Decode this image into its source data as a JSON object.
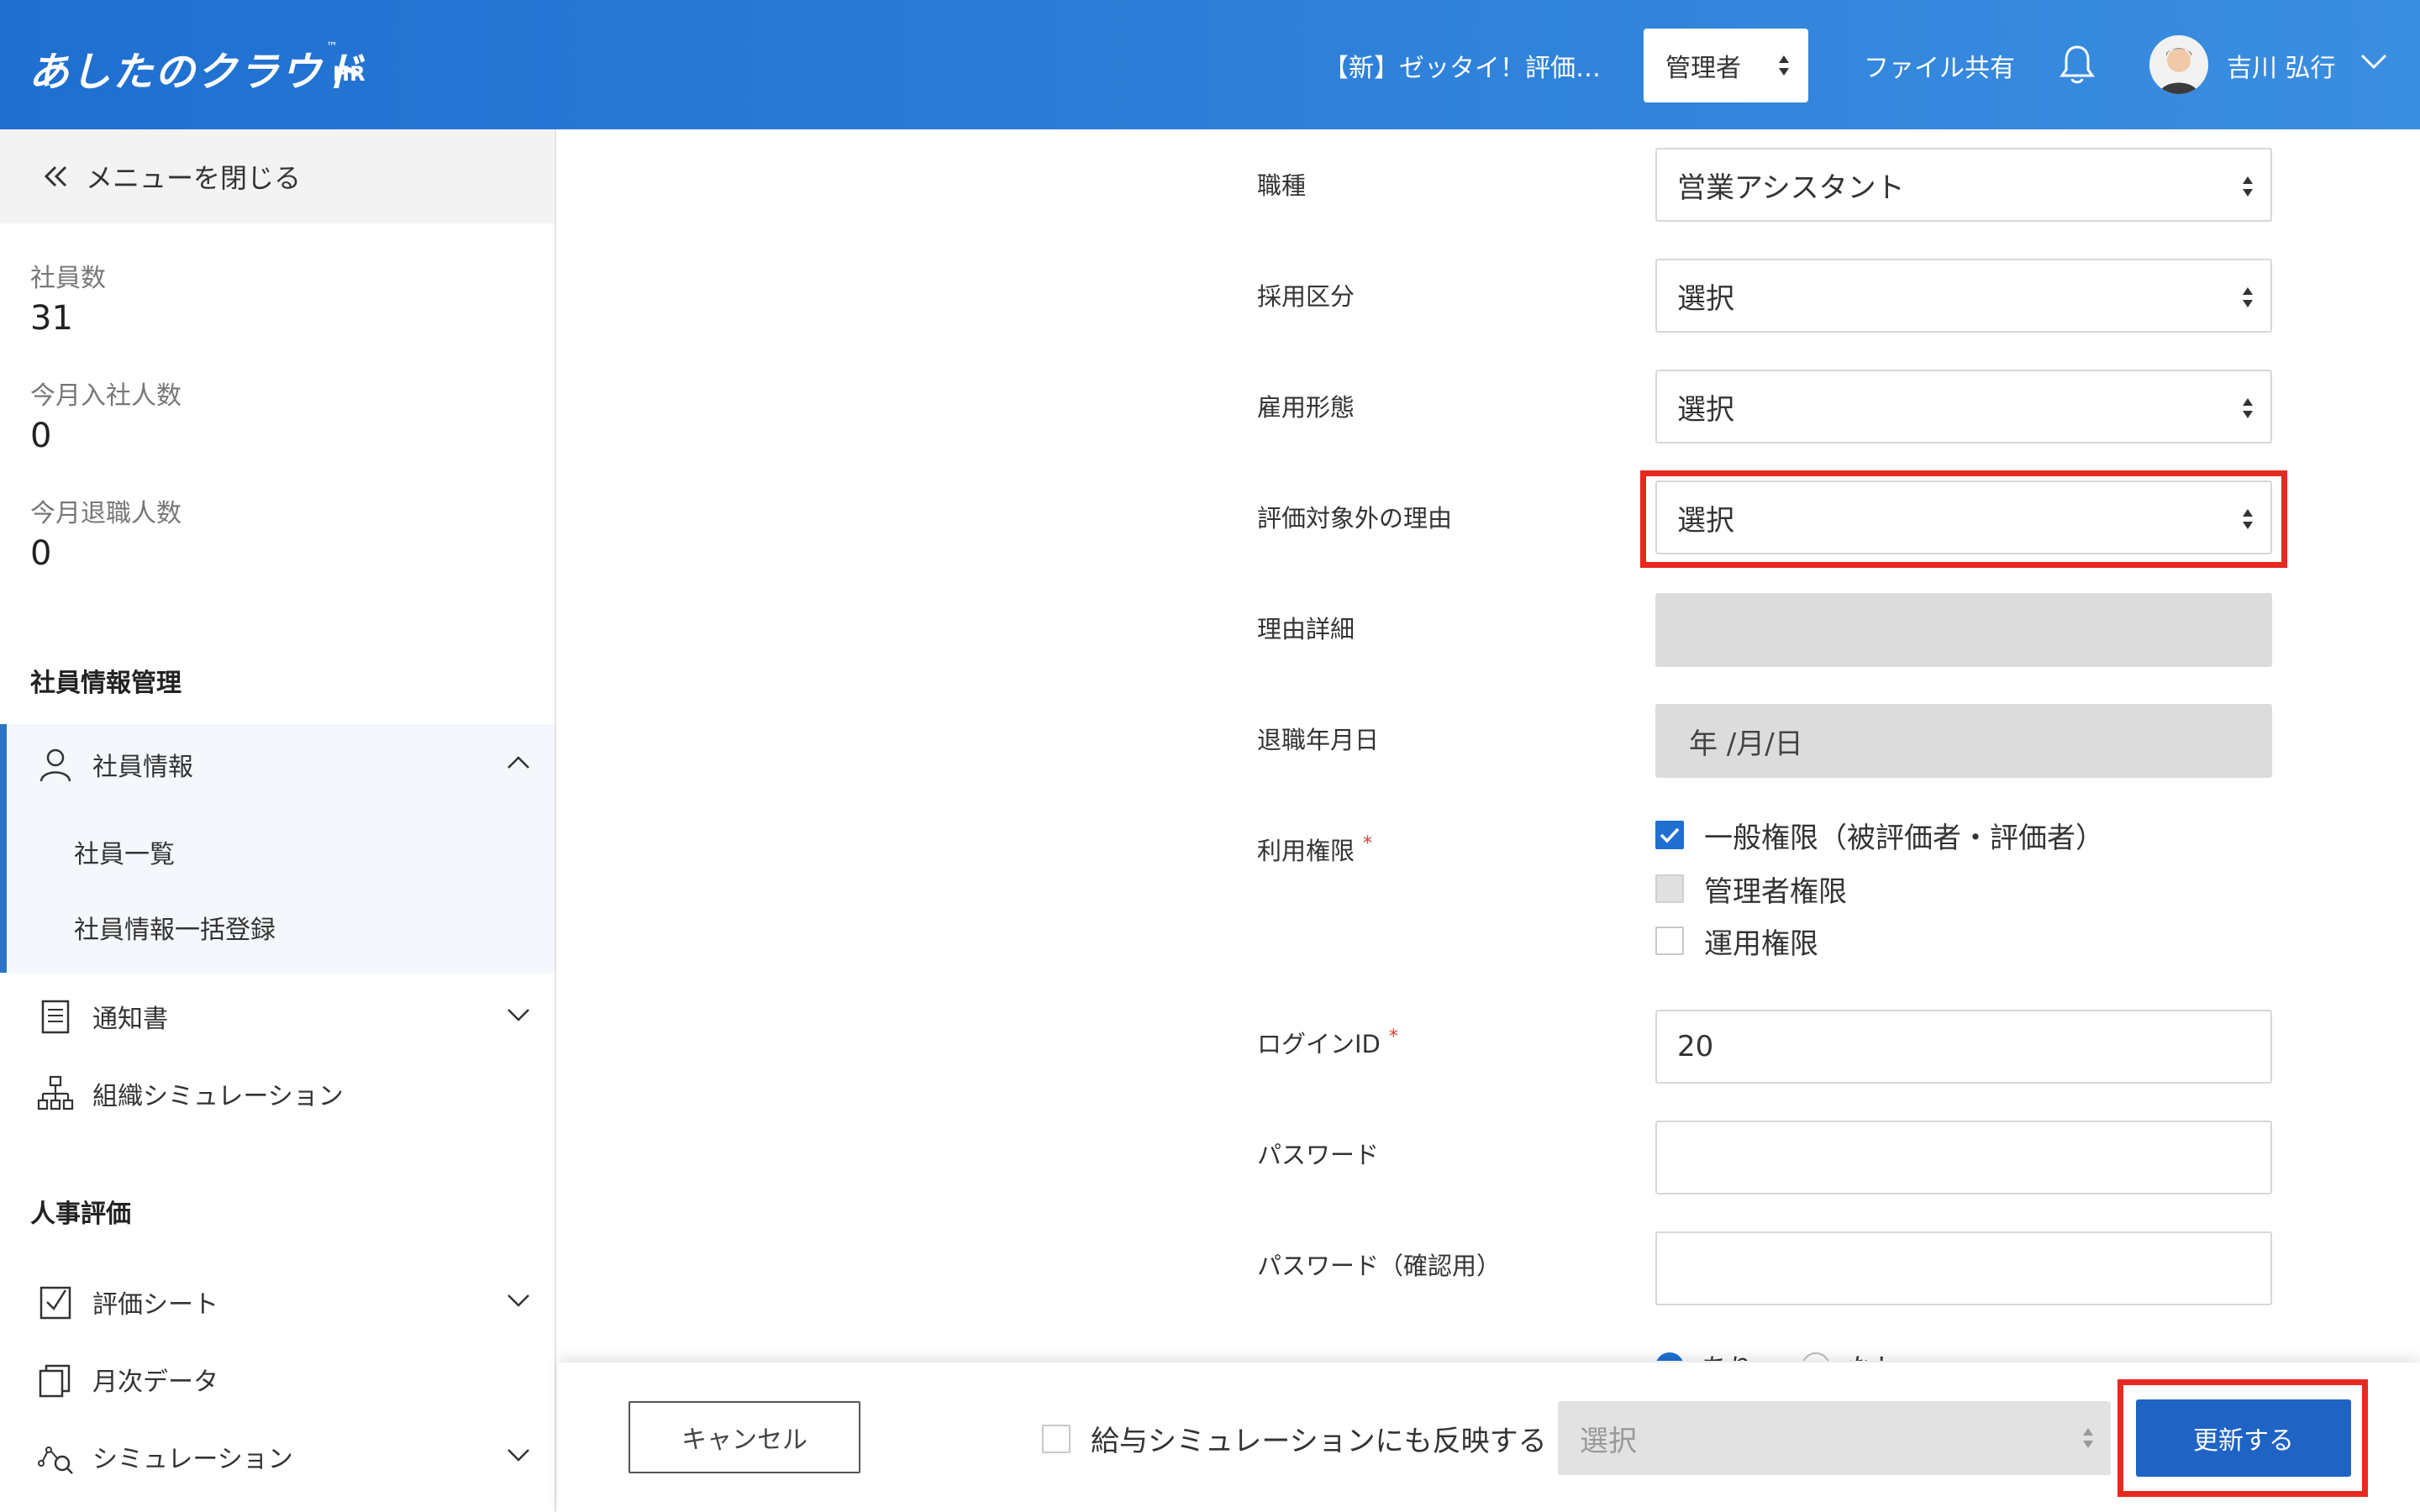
{
  "header": {
    "logo": "あしたのクラウド",
    "logo_sub": "HR",
    "logo_tm": "™",
    "evaluation_title": "【新】ゼッタイ！評価…",
    "role_selected": "管理者",
    "file_share": "ファイル共有",
    "user_name": "吉川 弘行"
  },
  "sidebar": {
    "close_menu": "メニューを閉じる",
    "stats": [
      {
        "label": "社員数",
        "value": "31"
      },
      {
        "label": "今月入社人数",
        "value": "0"
      },
      {
        "label": "今月退職人数",
        "value": "0"
      }
    ],
    "section_employee": "社員情報管理",
    "employee_info": "社員情報",
    "employee_list": "社員一覧",
    "employee_bulk": "社員情報一括登録",
    "notice": "通知書",
    "org_sim": "組織シミュレーション",
    "section_hr": "人事評価",
    "eval_sheet": "評価シート",
    "monthly_data": "月次データ",
    "simulation": "シミュレーション"
  },
  "form": {
    "job_type": {
      "label": "職種",
      "value": "営業アシスタント"
    },
    "hire_category": {
      "label": "採用区分",
      "value": "選択"
    },
    "employment_type": {
      "label": "雇用形態",
      "value": "選択"
    },
    "exclusion_reason": {
      "label": "評価対象外の理由",
      "value": "選択"
    },
    "reason_detail": {
      "label": "理由詳細",
      "value": ""
    },
    "retire_date": {
      "label": "退職年月日",
      "placeholder": "年 /月/日"
    },
    "permissions": {
      "label": "利用権限",
      "required_mark": "*",
      "options": [
        {
          "label": "一般権限（被評価者・評価者）",
          "state": "checked"
        },
        {
          "label": "管理者権限",
          "state": "disabled"
        },
        {
          "label": "運用権限",
          "state": "unchecked"
        }
      ]
    },
    "login_id": {
      "label": "ログインID",
      "required_mark": "*",
      "value": "20"
    },
    "password": {
      "label": "パスワード",
      "value": ""
    },
    "password_confirm": {
      "label": "パスワード（確認用）",
      "value": ""
    },
    "partial_radio": {
      "yes": "あり",
      "no": "なし"
    }
  },
  "footer": {
    "cancel": "キャンセル",
    "reflect_salary": "給与シミュレーションにも反映する",
    "select_placeholder": "選択",
    "update": "更新する"
  },
  "colors": {
    "header_start": "#1f6fd0",
    "header_end": "#3a8ee0",
    "accent": "#1f63c5",
    "highlight": "#e8291f",
    "required": "#e23a3a"
  }
}
